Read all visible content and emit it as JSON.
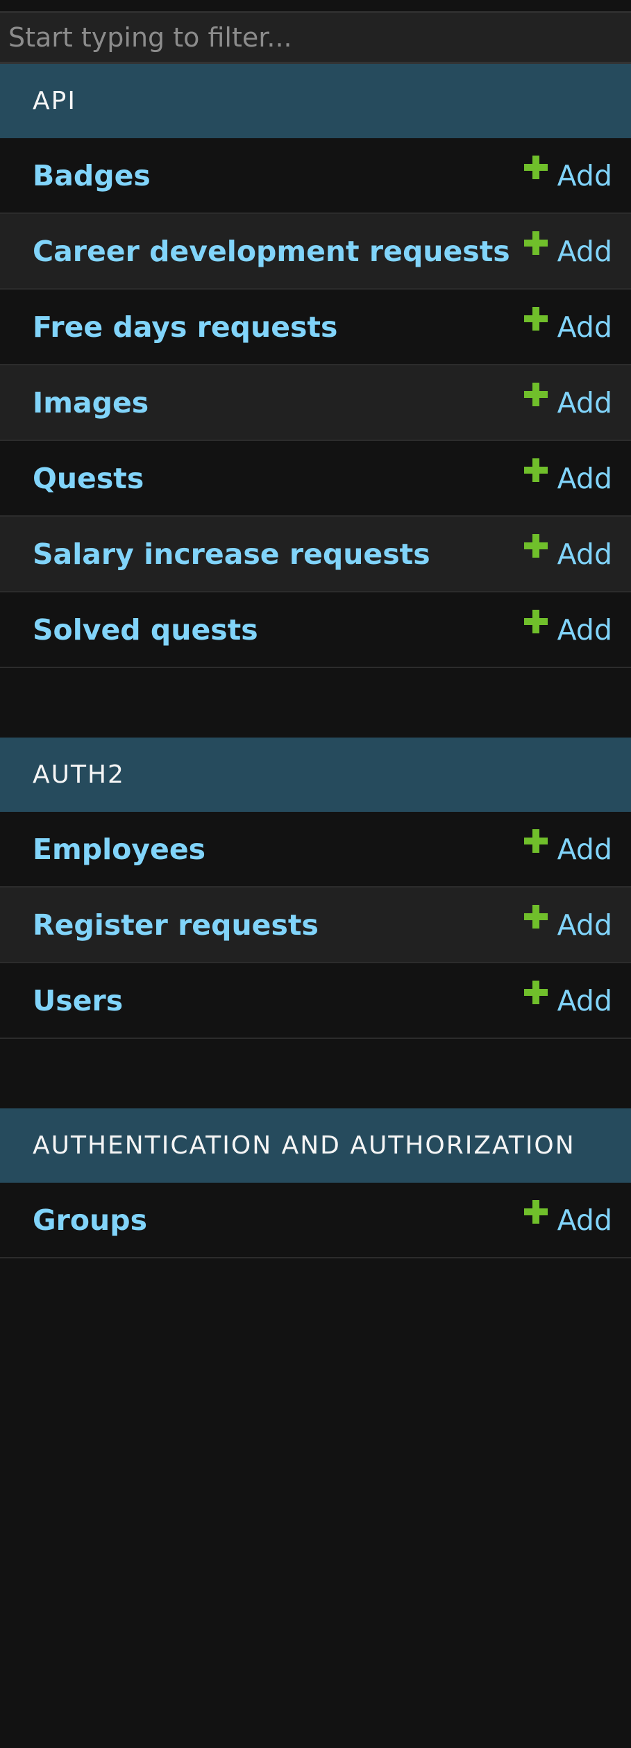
{
  "filter": {
    "placeholder": "Start typing to filter..."
  },
  "modules": [
    {
      "title": "API",
      "models": [
        {
          "name": "Badges",
          "add": "Add"
        },
        {
          "name": "Career development requests",
          "add": "Add"
        },
        {
          "name": "Free days requests",
          "add": "Add"
        },
        {
          "name": "Images",
          "add": "Add"
        },
        {
          "name": "Quests",
          "add": "Add"
        },
        {
          "name": "Salary increase requests",
          "add": "Add"
        },
        {
          "name": "Solved quests",
          "add": "Add"
        }
      ]
    },
    {
      "title": "AUTH2",
      "models": [
        {
          "name": "Employees",
          "add": "Add"
        },
        {
          "name": "Register requests",
          "add": "Add"
        },
        {
          "name": "Users",
          "add": "Add"
        }
      ]
    },
    {
      "title": "AUTHENTICATION AND AUTHORIZATION",
      "models": [
        {
          "name": "Groups",
          "add": "Add"
        }
      ]
    }
  ],
  "colors": {
    "header_bg": "#264b5d",
    "link": "#81d4fa",
    "plus_icon": "#70bf2b",
    "row_alt_bg": "#212121",
    "page_bg": "#121212"
  },
  "icons": {
    "add": "plus-icon"
  }
}
